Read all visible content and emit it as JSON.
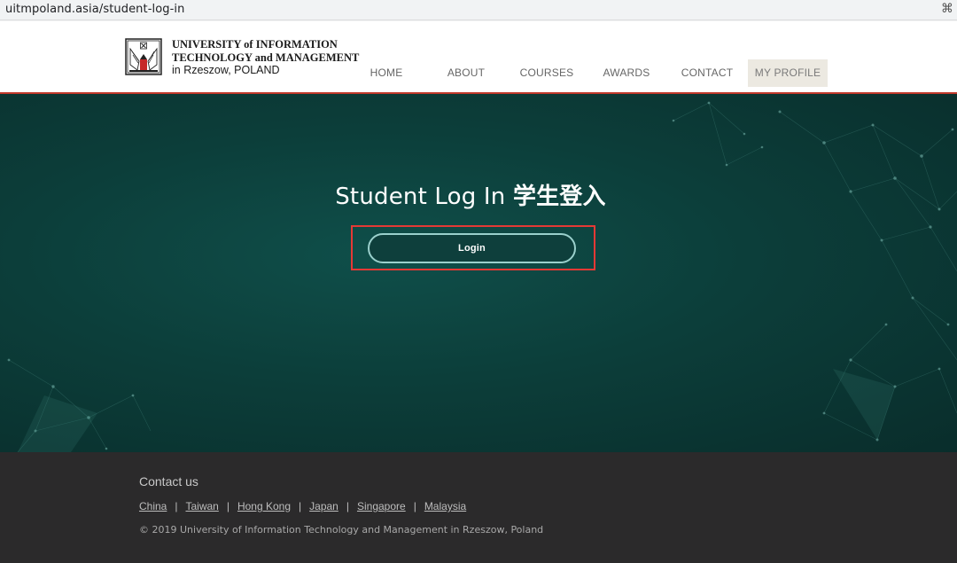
{
  "browser": {
    "url": "uitmpoland.asia/student-log-in",
    "bookmark_icon": "bookmark-icon"
  },
  "header": {
    "logo": {
      "line1": "UNIVERSITY of INFORMATION",
      "line2": "TECHNOLOGY and MANAGEMENT",
      "line3": "in Rzeszow, POLAND",
      "crest_icon": "university-crest-icon"
    },
    "nav": [
      {
        "label": "HOME"
      },
      {
        "label": "ABOUT"
      },
      {
        "label": "COURSES"
      },
      {
        "label": "AWARDS"
      },
      {
        "label": "CONTACT"
      },
      {
        "label": "MY PROFILE",
        "active": true
      }
    ],
    "accent_color": "#c0392b"
  },
  "hero": {
    "title": "Student Log In ",
    "title_cn": "学生登入",
    "login_label": "Login",
    "highlight_color": "#e53935",
    "background_color": "#0c3e3a"
  },
  "footer": {
    "contact_title": "Contact us",
    "links": [
      "China",
      "Taiwan",
      "Hong Kong",
      "Japan",
      "Singapore",
      "Malaysia "
    ],
    "separator": "|",
    "copyright": "© 2019 University of Information Technology and Management in Rzeszow, Poland",
    "background_color": "#2b2a2b"
  }
}
